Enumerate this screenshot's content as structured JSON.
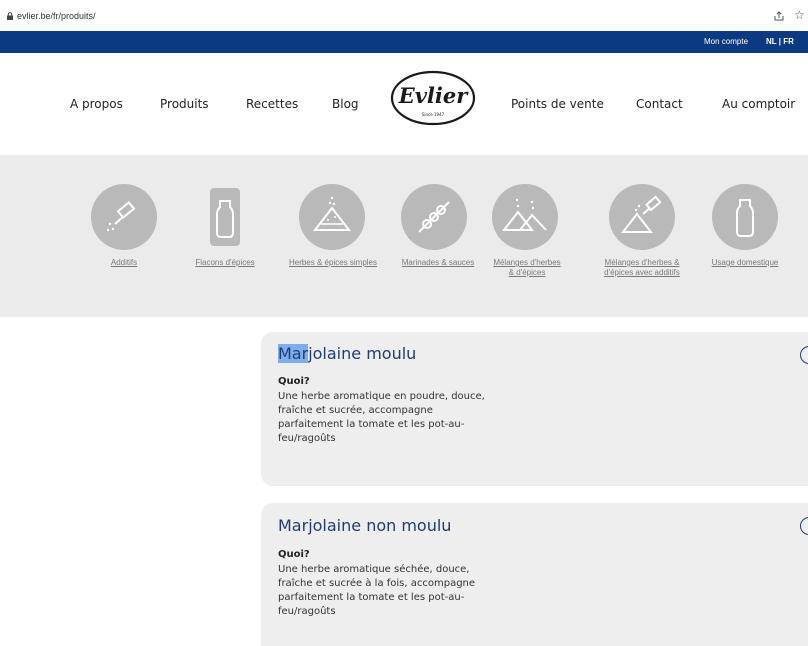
{
  "browser": {
    "url": "evlier.be/fr/produits/",
    "icons": [
      "lock-icon",
      "share-icon",
      "star-icon"
    ]
  },
  "topbar": {
    "account": "Mon compte",
    "languages": "NL | FR"
  },
  "nav": {
    "items": [
      "A propos",
      "Produits",
      "Recettes",
      "Blog",
      "Points de vente",
      "Contact",
      "Au comptoir"
    ],
    "logo": {
      "name": "Evlier",
      "since": "Since 1947"
    }
  },
  "categories": [
    {
      "label": "Additifs",
      "icon": "spray-icon"
    },
    {
      "label": "Flacons d'épices",
      "icon": "bottle-icon"
    },
    {
      "label": "Herbes & épices simples",
      "icon": "spice-pile-icon"
    },
    {
      "label": "Marinades & sauces",
      "icon": "skewer-icon"
    },
    {
      "label": "Mélanges d'herbes & d'épices",
      "icon": "spice-piles-icon"
    },
    {
      "label": "Mélanges d'herbes & d'épices avec additifs",
      "icon": "spice-spray-icon"
    },
    {
      "label": "Usage domestique",
      "icon": "bottle-icon"
    }
  ],
  "products": [
    {
      "title_selected": "Mar",
      "title_rest": "jolaine moulu",
      "question": "Quoi?",
      "description": "Une herbe aromatique en poudre, douce, fraîche et sucrée, accompagne parfaitement la tomate et les pot-au-feu/ragoûts"
    },
    {
      "title": "Marjolaine non moulu",
      "question": "Quoi?",
      "description": "Une herbe aromatique séchée, douce, fraîche et sucrée à la fois, accompagne parfaitement la tomate et les pot-au-feu/ragoûts"
    }
  ],
  "colors": {
    "topbar": "#0b3a82",
    "title": "#1f3c76",
    "category_band": "#ebebeb",
    "category_icon": "#b9b9b9",
    "selection": "#7faeed"
  }
}
